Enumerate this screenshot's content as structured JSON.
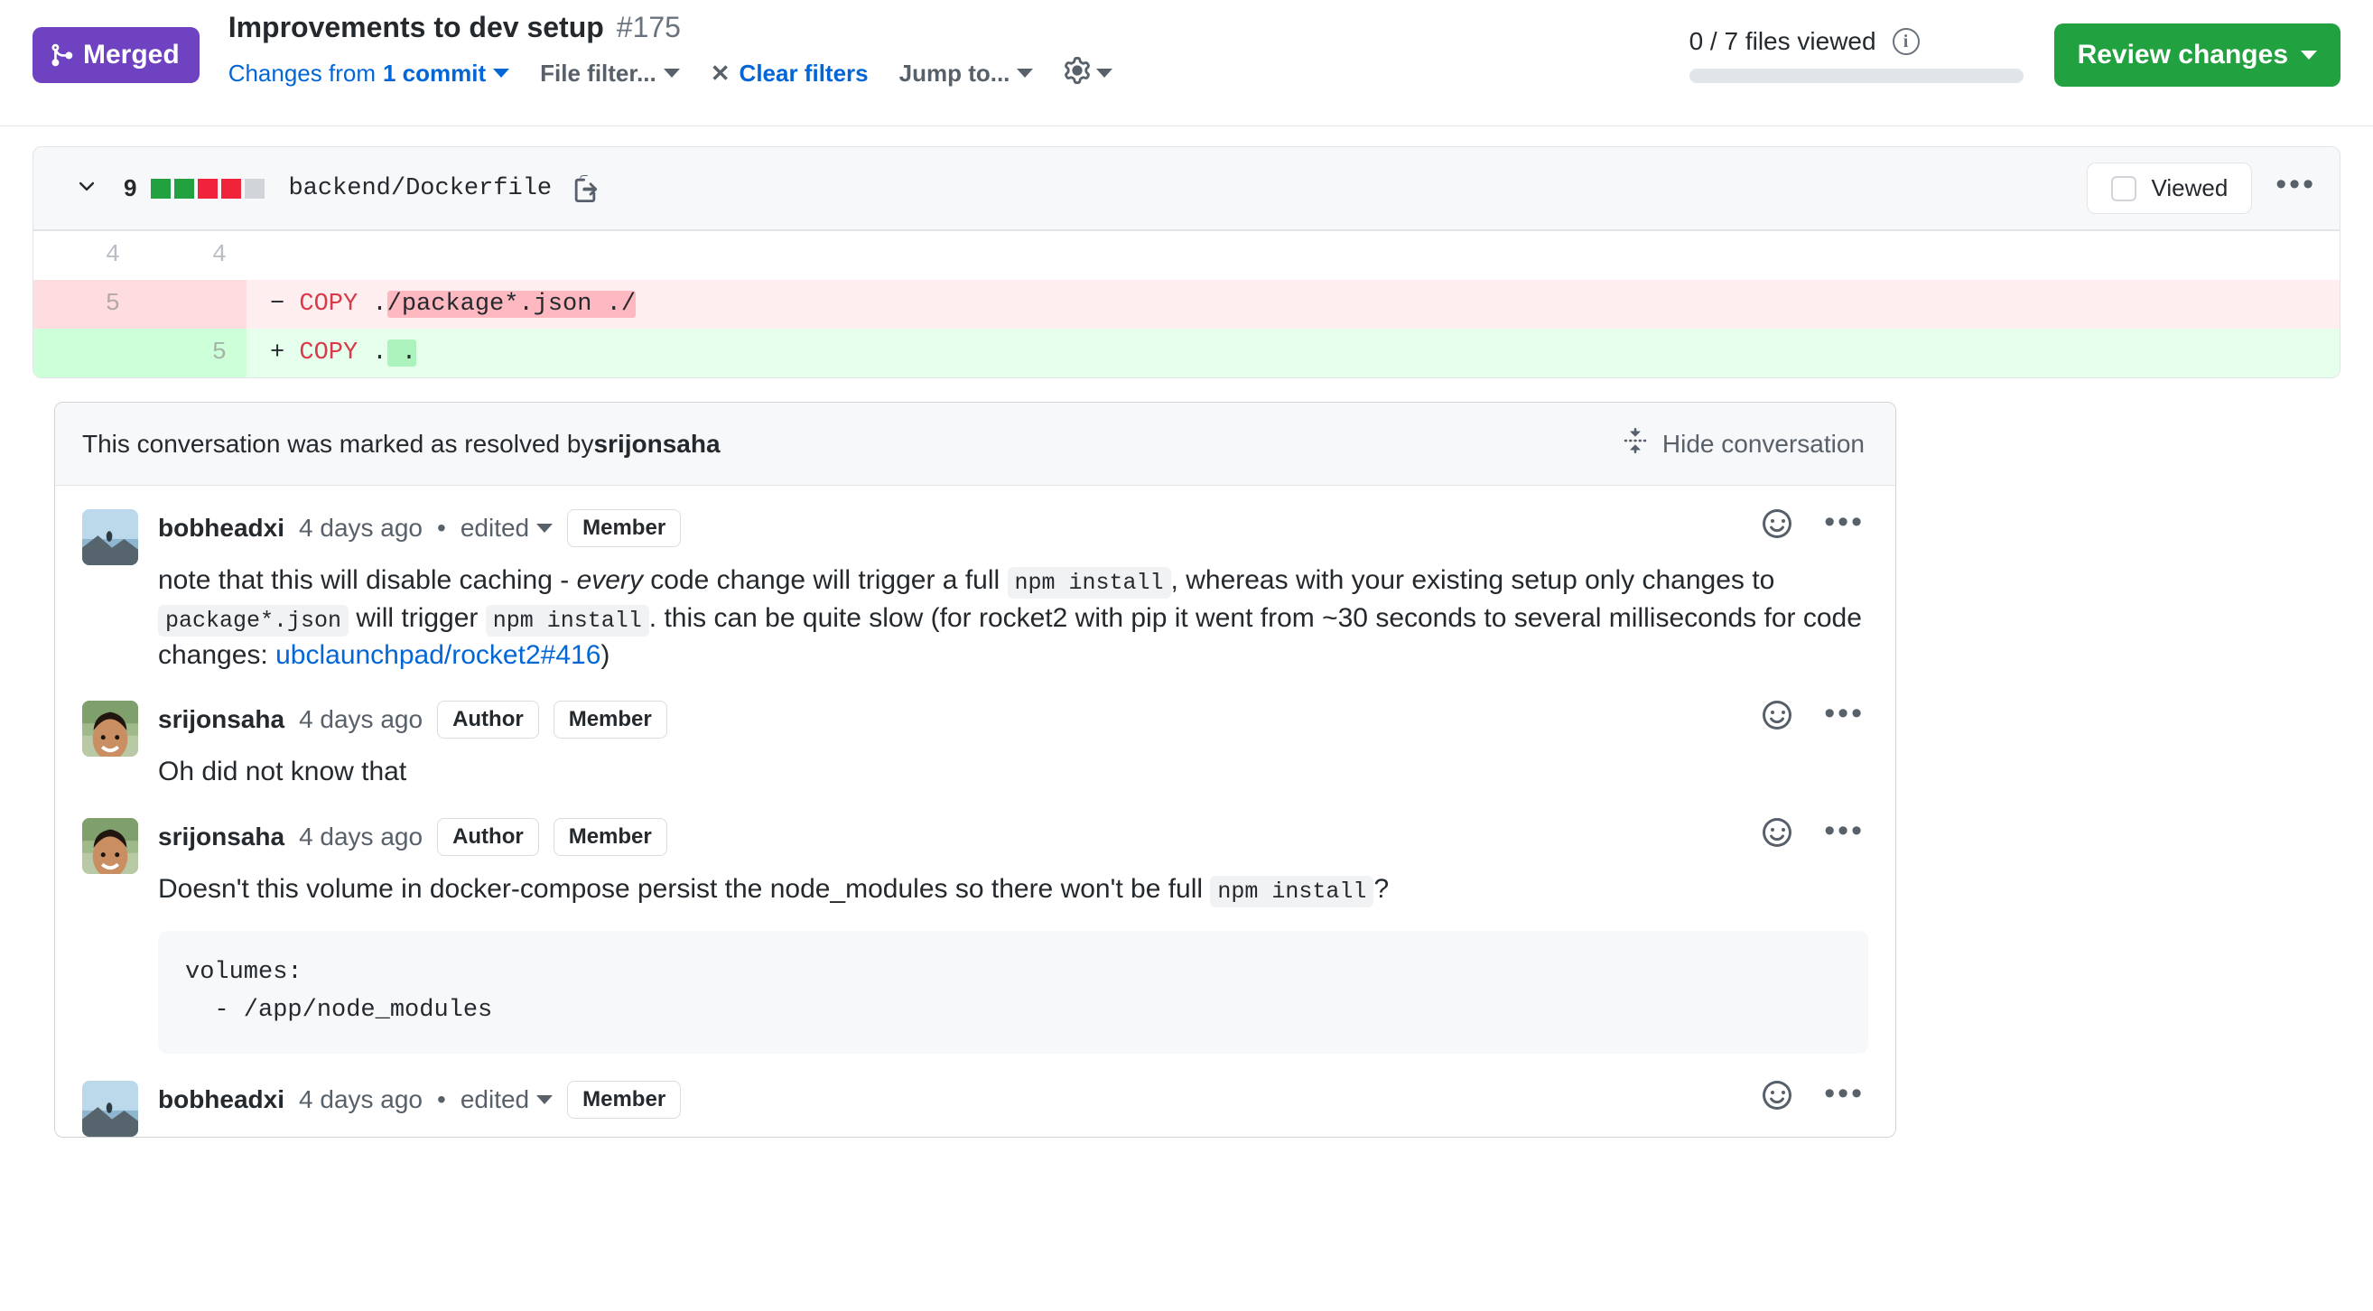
{
  "header": {
    "status_badge": "Merged",
    "status_icon": "git-merge-icon",
    "title": "Improvements to dev setup",
    "number": "#175",
    "changes_from_prefix": "Changes from ",
    "changes_from_commits": "1 commit",
    "file_filter_label": "File filter...",
    "clear_filters_label": "Clear filters",
    "clear_filters_x": "✕",
    "jump_to_label": "Jump to...",
    "gear_icon": "gear-icon",
    "files_viewed": "0 / 7 files viewed",
    "info_icon_char": "i",
    "review_changes_label": "Review changes",
    "progress_percent": 0,
    "accent_link_color": "#0366d6",
    "merged_color": "#6f42c1",
    "review_button_color": "#22a141"
  },
  "file": {
    "chevron": "⌄",
    "changes_count": "9",
    "diffstat_blocks": [
      "add",
      "add",
      "del",
      "del",
      "neutral"
    ],
    "path": "backend/Dockerfile",
    "copy_icon": "copy-path-icon",
    "viewed_label": "Viewed",
    "viewed_checked": false,
    "kebab_label": "•••"
  },
  "diff": {
    "rows": [
      {
        "type": "context",
        "old_line": "4",
        "new_line": "4",
        "marker": "",
        "code": ""
      },
      {
        "type": "deletion",
        "old_line": "5",
        "new_line": "",
        "marker": "−",
        "keyword": "COPY",
        "prefix": " .",
        "highlight": "/package*.json ./"
      },
      {
        "type": "addition",
        "old_line": "",
        "new_line": "5",
        "marker": "+",
        "keyword": "COPY",
        "prefix": " .",
        "highlight": " ."
      }
    ]
  },
  "thread": {
    "resolved_text_prefix": "This conversation was marked as resolved by ",
    "resolved_by": "srijonsaha",
    "hide_conversation_label": "Hide conversation",
    "hide_conversation_icon": "fold-icon",
    "comments": [
      {
        "author": "bobheadxi",
        "avatar_kind": "landscape",
        "time": "4 days ago",
        "dot": "•",
        "edited": "edited",
        "badges": [
          "Member"
        ],
        "reaction_icon": "smiley-icon",
        "menu_icon": "kebab-menu-icon",
        "body_segments": [
          {
            "t": "text",
            "v": "note that this will disable caching - "
          },
          {
            "t": "em",
            "v": "every"
          },
          {
            "t": "text",
            "v": " code change will trigger a full "
          },
          {
            "t": "code",
            "v": "npm install"
          },
          {
            "t": "text",
            "v": ", whereas with your existing setup only changes to "
          },
          {
            "t": "code",
            "v": "package*.json"
          },
          {
            "t": "text",
            "v": " will trigger "
          },
          {
            "t": "code",
            "v": "npm install"
          },
          {
            "t": "text",
            "v": ". this can be quite slow (for rocket2 with pip it went from ~30 seconds to several milliseconds for code changes: "
          },
          {
            "t": "link",
            "v": "ubclaunchpad/rocket2#416"
          },
          {
            "t": "text",
            "v": ")"
          }
        ],
        "code_block": null
      },
      {
        "author": "srijonsaha",
        "avatar_kind": "portrait",
        "time": "4 days ago",
        "dot": "",
        "edited": "",
        "badges": [
          "Author",
          "Member"
        ],
        "reaction_icon": "smiley-icon",
        "menu_icon": "kebab-menu-icon",
        "body_segments": [
          {
            "t": "text",
            "v": "Oh did not know that"
          }
        ],
        "code_block": null
      },
      {
        "author": "srijonsaha",
        "avatar_kind": "portrait",
        "time": "4 days ago",
        "dot": "",
        "edited": "",
        "badges": [
          "Author",
          "Member"
        ],
        "reaction_icon": "smiley-icon",
        "menu_icon": "kebab-menu-icon",
        "body_segments": [
          {
            "t": "text",
            "v": "Doesn't this volume in docker-compose persist the node_modules so there won't be full "
          },
          {
            "t": "code",
            "v": "npm install"
          },
          {
            "t": "text",
            "v": "?"
          }
        ],
        "code_block": "volumes:\n  - /app/node_modules"
      },
      {
        "author": "bobheadxi",
        "avatar_kind": "landscape",
        "time": "4 days ago",
        "dot": "•",
        "edited": "edited",
        "badges": [
          "Member"
        ],
        "reaction_icon": "smiley-icon",
        "menu_icon": "kebab-menu-icon",
        "body_segments": [],
        "code_block": null
      }
    ]
  }
}
